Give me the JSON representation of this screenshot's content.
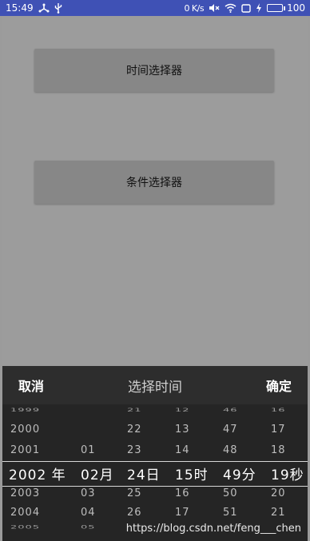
{
  "status_bar": {
    "time": "15:49",
    "net_speed": "0 K/s",
    "battery_level": "100",
    "battery_fraction": 1.0,
    "icons": [
      "usb-share-icon",
      "usb-icon",
      "mute-icon",
      "wifi-icon",
      "screen-icon",
      "charging-icon",
      "battery-icon"
    ]
  },
  "main": {
    "time_picker_button": "时间选择器",
    "condition_picker_button": "条件选择器"
  },
  "picker": {
    "cancel": "取消",
    "title": "选择时间",
    "confirm": "确定",
    "rows": [
      {
        "year": "1999",
        "month": "",
        "day": "21",
        "hour": "12",
        "minute": "46",
        "second": "16"
      },
      {
        "year": "2000",
        "month": "",
        "day": "22",
        "hour": "13",
        "minute": "47",
        "second": "17"
      },
      {
        "year": "2001",
        "month": "01",
        "day": "23",
        "hour": "14",
        "minute": "48",
        "second": "18"
      },
      {
        "year": "2002 年",
        "month": "02月",
        "day": "24日",
        "hour": "15时",
        "minute": "49分",
        "second": "19秒"
      },
      {
        "year": "2003",
        "month": "03",
        "day": "25",
        "hour": "16",
        "minute": "50",
        "second": "20"
      },
      {
        "year": "2004",
        "month": "04",
        "day": "26",
        "hour": "17",
        "minute": "51",
        "second": "21"
      },
      {
        "year": "2005",
        "month": "05",
        "day": "",
        "hour": "",
        "minute": "",
        "second": ""
      }
    ]
  },
  "watermark": "https://blog.csdn.net/feng___chen"
}
